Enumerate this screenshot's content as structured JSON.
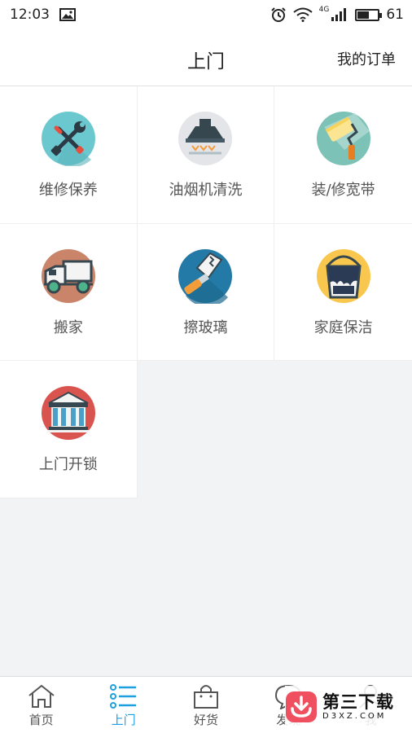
{
  "status_bar": {
    "time": "12:03",
    "network": "4G",
    "battery": "61",
    "battery_level": 0.61
  },
  "header": {
    "title": "上门",
    "orders_link": "我的订单"
  },
  "services": [
    {
      "label": "维修保养",
      "icon": "wrench-screwdriver-icon"
    },
    {
      "label": "油烟机清洗",
      "icon": "range-hood-icon"
    },
    {
      "label": "装/修宽带",
      "icon": "paint-roller-icon"
    },
    {
      "label": "搬家",
      "icon": "truck-icon"
    },
    {
      "label": "擦玻璃",
      "icon": "window-cleaning-icon"
    },
    {
      "label": "家庭保洁",
      "icon": "paint-bucket-icon"
    },
    {
      "label": "上门开锁",
      "icon": "building-icon"
    }
  ],
  "tabs": [
    {
      "label": "首页",
      "icon": "home-icon"
    },
    {
      "label": "上门",
      "icon": "list-icon"
    },
    {
      "label": "好货",
      "icon": "shopping-bag-icon"
    },
    {
      "label": "发现",
      "icon": "chat-icon"
    },
    {
      "label": "我",
      "icon": "user-icon"
    }
  ],
  "active_tab": "上门",
  "colors": {
    "accent": "#1ea0e0",
    "background": "#f2f3f5"
  },
  "watermark": {
    "brand": "第三下载",
    "domain": "D3XZ.COM"
  }
}
